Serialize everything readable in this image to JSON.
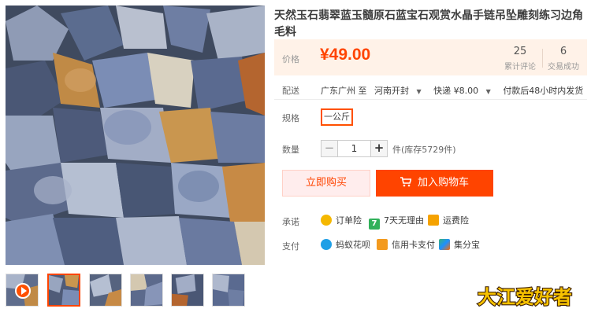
{
  "product": {
    "title": "天然玉石翡翠蓝玉髓原石蓝宝石观赏水晶手链吊坠雕刻练习边角毛料"
  },
  "price": {
    "label": "价格",
    "value": "¥49.00"
  },
  "stats": {
    "reviews_count": "25",
    "reviews_label": "累计评论",
    "sales_count": "6",
    "sales_label": "交易成功"
  },
  "shipping": {
    "label": "配送",
    "from": "广东广州 至",
    "to": "河南开封",
    "method": "快递 ¥8.00",
    "dispatch": "付款后48小时内发货"
  },
  "spec": {
    "label": "规格",
    "option": "一公斤"
  },
  "quantity": {
    "label": "数量",
    "minus": "−",
    "value": "1",
    "plus": "+",
    "stock": "件(库存5729件)"
  },
  "actions": {
    "buy_now": "立即购买",
    "add_to_cart": "加入购物车"
  },
  "promise": {
    "label": "承诺",
    "items": [
      "订单险",
      "7天无理由",
      "运费险"
    ],
    "icon_7_text": "7"
  },
  "payment": {
    "label": "支付",
    "items": [
      "蚂蚁花呗",
      "信用卡支付",
      "集分宝"
    ]
  },
  "watermark": {
    "text": "大江爱好者",
    "colors": {
      "fill": "#f7c200",
      "stroke": "#3a1d00"
    }
  },
  "colors": {
    "accent": "#ff4400",
    "price_bg": "#fff2e8",
    "buy_bg": "#ffeded"
  }
}
